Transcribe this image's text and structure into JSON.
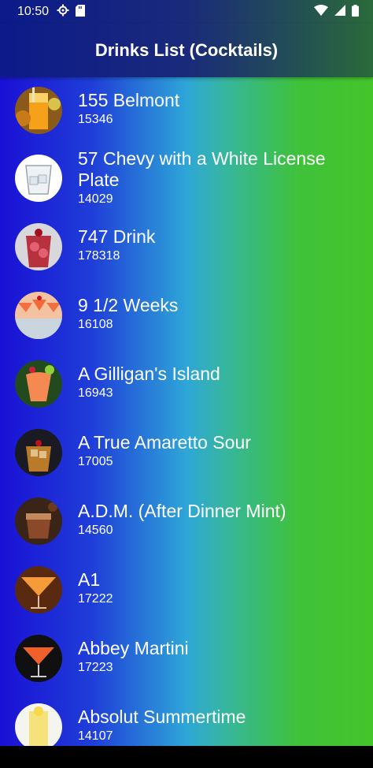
{
  "status_bar": {
    "time": "10:50"
  },
  "app_bar": {
    "title": "Drinks List (Cocktails)"
  },
  "drinks": [
    {
      "name": "155 Belmont",
      "id": "15346",
      "icon": "orange-drink-thumbnail"
    },
    {
      "name": "57 Chevy with a White License Plate",
      "id": "14029",
      "icon": "clear-glass-thumbnail"
    },
    {
      "name": "747 Drink",
      "id": "178318",
      "icon": "red-drink-thumbnail"
    },
    {
      "name": "9 1/2 Weeks",
      "id": "16108",
      "icon": "orange-cocktails-thumbnail"
    },
    {
      "name": "A Gilligan's Island",
      "id": "16943",
      "icon": "tropical-drink-thumbnail"
    },
    {
      "name": "A True Amaretto Sour",
      "id": "17005",
      "icon": "amber-drink-thumbnail"
    },
    {
      "name": "A.D.M. (After Dinner Mint)",
      "id": "14560",
      "icon": "brown-drink-thumbnail"
    },
    {
      "name": "A1",
      "id": "17222",
      "icon": "martini-thumbnail"
    },
    {
      "name": "Abbey Martini",
      "id": "17223",
      "icon": "orange-martini-thumbnail"
    },
    {
      "name": "Absolut Summertime",
      "id": "14107",
      "icon": "yellow-drink-thumbnail"
    }
  ]
}
